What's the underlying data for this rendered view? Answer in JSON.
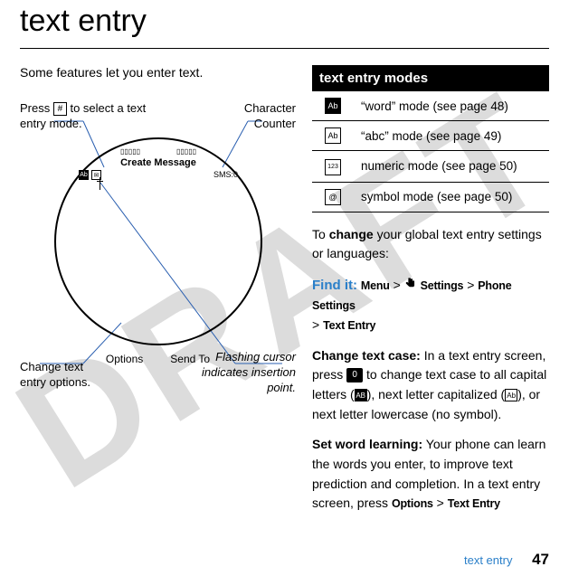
{
  "watermark": "DRAFT",
  "heading": "text entry",
  "intro": "Some features let you enter text.",
  "annotations": {
    "topLeft": {
      "prefix": "Press ",
      "key": "#",
      "suffix": " to select a text entry mode."
    },
    "topRight": "Character Counter",
    "bottomLeft": "Change text entry options.",
    "bottomRight": "Flashing cursor indicates insertion point."
  },
  "diagram": {
    "screenTitle": "Create Message",
    "smsCounter": "SMS:0",
    "iconWord": "Ab",
    "iconMsgGlyph": "✉",
    "softkeyLeft": "Options",
    "softkeyRight": "Send To"
  },
  "modesTable": {
    "header": "text entry modes",
    "rows": [
      {
        "icon": "Ab",
        "filled": true,
        "desc": "“word” mode (see page 48)"
      },
      {
        "icon": "Ab",
        "filled": false,
        "desc": "“abc” mode (see page 49)"
      },
      {
        "icon": "123",
        "filled": false,
        "desc": "numeric mode (see page 50)"
      },
      {
        "icon": "@",
        "filled": false,
        "desc": "symbol mode (see page 50)"
      }
    ]
  },
  "body": {
    "changeIntro": {
      "prefix": "To ",
      "bold": "change",
      "suffix": " your global text entry settings or languages:"
    },
    "findIt": {
      "label": "Find it:",
      "path": {
        "m1": "Menu",
        "s1": "Settings",
        "s2": "Phone Settings",
        "s3": "Text Entry",
        "sep": ">"
      }
    },
    "changeCase": {
      "bold": "Change text case:",
      "text1": " In a text entry screen, press ",
      "key": "0",
      "text2": " to change text case to all capital letters (",
      "iconAllCaps": "AB",
      "text3": "), next letter capitalized (",
      "iconCap": "Ab",
      "text4": "), or next letter lowercase (no symbol)."
    },
    "wordLearning": {
      "bold": "Set word learning:",
      "text": " Your phone can learn the words you enter, to improve text prediction and completion. In a text entry screen, press ",
      "m1": "Options",
      "sep": ">",
      "m2": "Text Entry"
    }
  },
  "footer": {
    "label": "text entry",
    "page": "47"
  }
}
